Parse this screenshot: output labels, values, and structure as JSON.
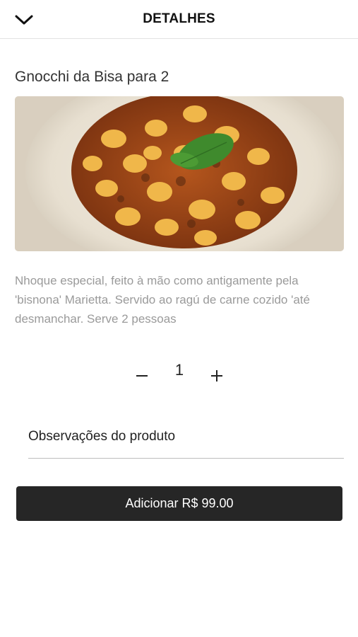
{
  "header": {
    "title": "DETALHES",
    "back_icon": "chevron-down-icon"
  },
  "product": {
    "name": "Gnocchi da Bisa para 2",
    "description": "Nhoque especial, feito à mão como antigamente pela 'bisnona' Marietta. Servido ao ragú de carne cozido 'até desmanchar. Serve 2 pessoas"
  },
  "quantity": {
    "value": "1",
    "minus_icon": "minus-icon",
    "plus_icon": "plus-icon"
  },
  "observations": {
    "label": "Observações do produto"
  },
  "add_button": {
    "label": "Adicionar R$ 99.00"
  },
  "colors": {
    "button_bg": "#262626",
    "description_text": "#9a9a9a"
  }
}
